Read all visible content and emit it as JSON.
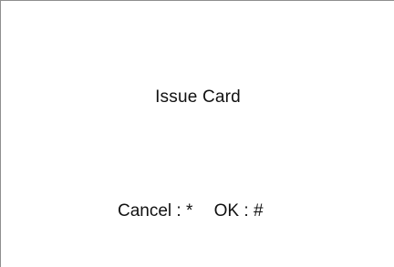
{
  "screen": {
    "title": "Issue Card",
    "soft_keys": {
      "cancel": "Cancel : *",
      "ok": "OK : #"
    }
  }
}
